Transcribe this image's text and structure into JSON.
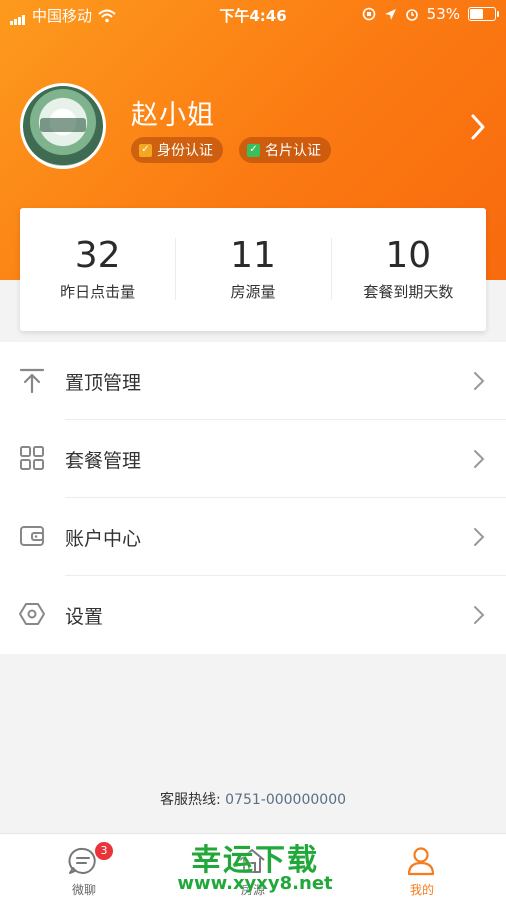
{
  "status_bar": {
    "carrier": "中国移动",
    "time": "下午4:46",
    "battery": "53%",
    "battery_level": 0.53
  },
  "profile": {
    "name": "赵小姐",
    "badges": [
      "身份认证",
      "名片认证"
    ]
  },
  "stats": [
    {
      "value": "32",
      "label": "昨日点击量"
    },
    {
      "value": "11",
      "label": "房源量"
    },
    {
      "value": "10",
      "label": "套餐到期天数"
    }
  ],
  "menu": [
    {
      "label": "置顶管理",
      "icon": "pin-top-icon"
    },
    {
      "label": "套餐管理",
      "icon": "grid-icon"
    },
    {
      "label": "账户中心",
      "icon": "wallet-icon"
    },
    {
      "label": "设置",
      "icon": "settings-icon"
    }
  ],
  "hotline": {
    "label": "客服热线:",
    "number": "0751-000000000"
  },
  "tabbar": {
    "tabs": [
      {
        "label": "微聊",
        "badge": "3",
        "icon": "chat-icon"
      },
      {
        "label": "房源",
        "icon": "house-icon"
      },
      {
        "label": "我的",
        "icon": "user-icon"
      }
    ]
  },
  "watermark": {
    "line1": "幸运下载",
    "line2": "www.xyxy8.net"
  },
  "colors": {
    "accent": "#f57c1f",
    "header_start": "#fd9a1d",
    "header_end": "#f86a0e",
    "badge_red": "#e8333a",
    "watermark_green": "#22a83a"
  }
}
